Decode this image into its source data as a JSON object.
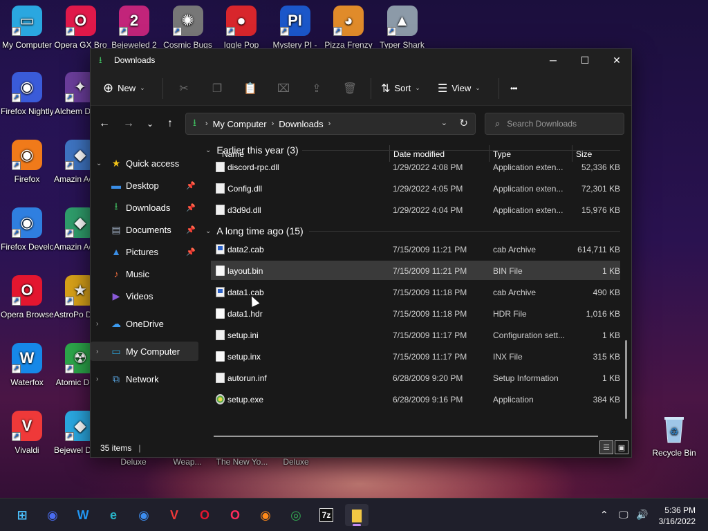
{
  "desktop": {
    "top_icons": [
      {
        "label": "My Computer",
        "icon": "monitor-icon",
        "color": "#2aa7e0"
      },
      {
        "label": "Opera GX Browser",
        "icon": "opera-gx-icon",
        "color": "#e0194a"
      },
      {
        "label": "Bejeweled 2",
        "icon": "bejeweled-icon",
        "color": "#c2247a"
      },
      {
        "label": "Cosmic Bugs",
        "icon": "cosmic-bugs-icon",
        "color": "#777777"
      },
      {
        "label": "Iggle Pop",
        "icon": "iggle-pop-icon",
        "color": "#d8262c"
      },
      {
        "label": "Mystery PI -",
        "icon": "mystery-pi-icon",
        "color": "#1b57c9"
      },
      {
        "label": "Pizza Frenzy",
        "icon": "pizza-icon",
        "color": "#e08b2a"
      },
      {
        "label": "Typer Shark",
        "icon": "shark-icon",
        "color": "#8c9aa8"
      }
    ],
    "left_icons": [
      {
        "label": "Firefox Nightly",
        "icon": "firefox-nightly-icon",
        "color": "#3a5bd9"
      },
      {
        "label": "Firefox",
        "icon": "firefox-icon",
        "color": "#f07a1a"
      },
      {
        "label": "Firefox Develop...",
        "icon": "firefox-dev-icon",
        "color": "#2f7fe0"
      },
      {
        "label": "Opera Browser",
        "icon": "opera-icon",
        "color": "#e3162f"
      },
      {
        "label": "Waterfox",
        "icon": "waterfox-icon",
        "color": "#1688e8"
      },
      {
        "label": "Vivaldi",
        "icon": "vivaldi-icon",
        "color": "#ef3939"
      }
    ],
    "second_col_icons": [
      {
        "label": "Alchem Delux",
        "icon": "alchemy-icon",
        "color": "#6a3d9a"
      },
      {
        "label": "Amazin Adventu",
        "icon": "amazing-adventures-icon",
        "color": "#3e74c2"
      },
      {
        "label": "Amazin Adventu",
        "icon": "amazing-adventures-2-icon",
        "color": "#2f9d6b"
      },
      {
        "label": "AstroPo Delux",
        "icon": "astropop-icon",
        "color": "#d7a019"
      },
      {
        "label": "Atomic Delux",
        "icon": "atomic-icon",
        "color": "#2ca64a"
      },
      {
        "label": "Bejewel Deluxe",
        "icon": "bejeweled-deluxe-icon",
        "color": "#2aa7e0"
      }
    ],
    "bottom_labels": [
      "Deluxe",
      "Weap...",
      "The New Yo...",
      "Deluxe"
    ],
    "recycle_bin": {
      "label": "Recycle Bin",
      "icon": "recycle-bin-icon"
    }
  },
  "window": {
    "title": "Downloads",
    "controls": {
      "minimize": "─",
      "maximize": "☐",
      "close": "✕"
    },
    "command_bar": {
      "new_label": "New",
      "sort_label": "Sort",
      "view_label": "View",
      "more_label": "•••"
    },
    "address": {
      "crumbs": [
        "My Computer",
        "Downloads"
      ],
      "search_placeholder": "Search Downloads"
    },
    "nav_pane": {
      "quick_access": "Quick access",
      "items": [
        {
          "label": "Desktop",
          "icon": "desktop-icon",
          "pinned": true
        },
        {
          "label": "Downloads",
          "icon": "download-icon",
          "pinned": true
        },
        {
          "label": "Documents",
          "icon": "documents-icon",
          "pinned": true
        },
        {
          "label": "Pictures",
          "icon": "pictures-icon",
          "pinned": true
        },
        {
          "label": "Music",
          "icon": "music-icon",
          "pinned": false
        },
        {
          "label": "Videos",
          "icon": "videos-icon",
          "pinned": false
        }
      ],
      "onedrive": "OneDrive",
      "my_computer": "My Computer",
      "network": "Network"
    },
    "columns": {
      "name": "Name",
      "date": "Date modified",
      "type": "Type",
      "size": "Size"
    },
    "groups": [
      {
        "label": "Earlier this year (3)",
        "files": [
          {
            "name": "discord-rpc.dll",
            "date": "1/29/2022 4:08 PM",
            "type": "Application exten...",
            "size": "52,336 KB",
            "icon": "dll-icon"
          },
          {
            "name": "Config.dll",
            "date": "1/29/2022 4:05 PM",
            "type": "Application exten...",
            "size": "72,301 KB",
            "icon": "dll-icon"
          },
          {
            "name": "d3d9d.dll",
            "date": "1/29/2022 4:04 PM",
            "type": "Application exten...",
            "size": "15,976 KB",
            "icon": "dll-icon"
          }
        ]
      },
      {
        "label": "A long time ago (15)",
        "files": [
          {
            "name": "data2.cab",
            "date": "7/15/2009 11:21 PM",
            "type": "cab Archive",
            "size": "614,711 KB",
            "icon": "cab-icon"
          },
          {
            "name": "layout.bin",
            "date": "7/15/2009 11:21 PM",
            "type": "BIN File",
            "size": "1 KB",
            "icon": "file-icon",
            "hover": true
          },
          {
            "name": "data1.cab",
            "date": "7/15/2009 11:18 PM",
            "type": "cab Archive",
            "size": "490 KB",
            "icon": "cab-icon"
          },
          {
            "name": "data1.hdr",
            "date": "7/15/2009 11:18 PM",
            "type": "HDR File",
            "size": "1,016 KB",
            "icon": "file-icon"
          },
          {
            "name": "setup.ini",
            "date": "7/15/2009 11:17 PM",
            "type": "Configuration sett...",
            "size": "1 KB",
            "icon": "ini-icon"
          },
          {
            "name": "setup.inx",
            "date": "7/15/2009 11:17 PM",
            "type": "INX File",
            "size": "315 KB",
            "icon": "file-icon"
          },
          {
            "name": "autorun.inf",
            "date": "6/28/2009 9:20 PM",
            "type": "Setup Information",
            "size": "1 KB",
            "icon": "inf-icon"
          },
          {
            "name": "setup.exe",
            "date": "6/28/2009 9:16 PM",
            "type": "Application",
            "size": "384 KB",
            "icon": "exe-icon"
          }
        ]
      }
    ],
    "status": {
      "count": "35 items"
    }
  },
  "taskbar": {
    "apps": [
      {
        "name": "start-button",
        "glyph": "⊞",
        "color": "#4cc2ff"
      },
      {
        "name": "firefox-nightly-taskbar",
        "glyph": "◉",
        "color": "#4a6cf0"
      },
      {
        "name": "waterfox-taskbar",
        "glyph": "W",
        "color": "#2196f3"
      },
      {
        "name": "edge-taskbar",
        "glyph": "e",
        "color": "#28b4c8"
      },
      {
        "name": "firefox-dev-taskbar",
        "glyph": "◉",
        "color": "#3d8ef0"
      },
      {
        "name": "vivaldi-taskbar",
        "glyph": "V",
        "color": "#ef3939"
      },
      {
        "name": "opera-taskbar",
        "glyph": "O",
        "color": "#e3162f"
      },
      {
        "name": "opera-gx-taskbar",
        "glyph": "O",
        "color": "#ff2c5c"
      },
      {
        "name": "firefox-taskbar",
        "glyph": "◉",
        "color": "#ff8a1a"
      },
      {
        "name": "chrome-taskbar",
        "glyph": "◎",
        "color": "#34a853"
      },
      {
        "name": "7zip-taskbar",
        "glyph": "7z",
        "color": "#ffffff"
      },
      {
        "name": "file-explorer-taskbar",
        "glyph": "▇",
        "color": "#f2c744",
        "active": true
      }
    ],
    "clock": {
      "time": "5:36 PM",
      "date": "3/16/2022"
    }
  }
}
